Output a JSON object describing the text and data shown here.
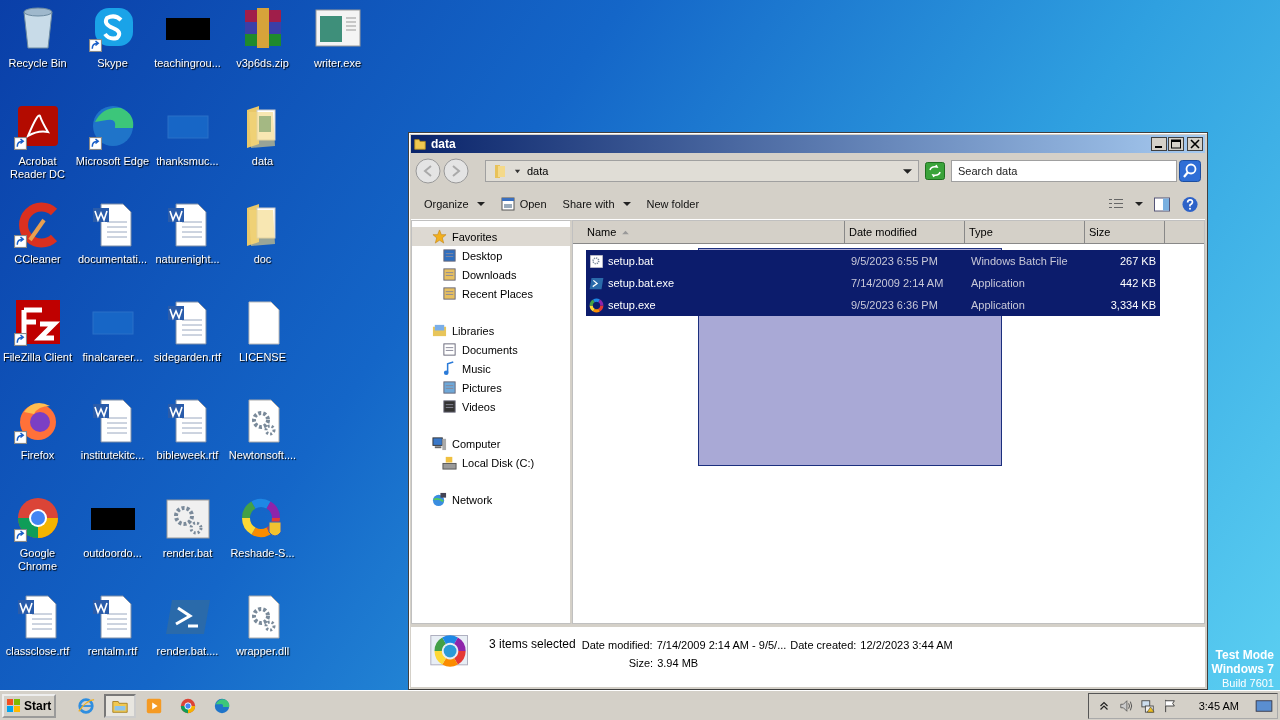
{
  "desktop": {
    "icons": [
      {
        "label": "Recycle Bin",
        "kind": "recycle",
        "shortcut": false
      },
      {
        "label": "Acrobat Reader DC",
        "kind": "acrobat",
        "shortcut": true
      },
      {
        "label": "CCleaner",
        "kind": "ccleaner",
        "shortcut": true
      },
      {
        "label": "FileZilla Client",
        "kind": "filezilla",
        "shortcut": true
      },
      {
        "label": "Firefox",
        "kind": "firefox",
        "shortcut": true
      },
      {
        "label": "Google Chrome",
        "kind": "chrome",
        "shortcut": true
      },
      {
        "label": "classclose.rtf",
        "kind": "word",
        "shortcut": false
      },
      {
        "label": "Skype",
        "kind": "skype",
        "shortcut": true
      },
      {
        "label": "Microsoft Edge",
        "kind": "edge",
        "shortcut": true
      },
      {
        "label": "documentati...",
        "kind": "word",
        "shortcut": false
      },
      {
        "label": "finalcareer...",
        "kind": "blank",
        "shortcut": false
      },
      {
        "label": "institutekitc...",
        "kind": "word",
        "shortcut": false
      },
      {
        "label": "outdoordo...",
        "kind": "black",
        "shortcut": false
      },
      {
        "label": "rentalm.rtf",
        "kind": "word",
        "shortcut": false
      },
      {
        "label": "teachingrou...",
        "kind": "black",
        "shortcut": false
      },
      {
        "label": "thanksmuc...",
        "kind": "blank",
        "shortcut": false
      },
      {
        "label": "naturenight...",
        "kind": "word",
        "shortcut": false
      },
      {
        "label": "sidegarden.rtf",
        "kind": "word",
        "shortcut": false
      },
      {
        "label": "bibleweek.rtf",
        "kind": "word",
        "shortcut": false
      },
      {
        "label": "render.bat",
        "kind": "gearwin",
        "shortcut": false
      },
      {
        "label": "render.bat....",
        "kind": "powershell",
        "shortcut": false
      },
      {
        "label": "v3p6ds.zip",
        "kind": "winrar",
        "shortcut": false
      },
      {
        "label": "data",
        "kind": "folderpic",
        "shortcut": false
      },
      {
        "label": "doc",
        "kind": "folder",
        "shortcut": false
      },
      {
        "label": "LICENSE",
        "kind": "file",
        "shortcut": false
      },
      {
        "label": "Newtonsoft....",
        "kind": "gear",
        "shortcut": false
      },
      {
        "label": "Reshade-S...",
        "kind": "ring",
        "shortcut": false
      },
      {
        "label": "wrapper.dll",
        "kind": "gear",
        "shortcut": false
      },
      {
        "label": "writer.exe",
        "kind": "window",
        "shortcut": false
      }
    ]
  },
  "window": {
    "title": "data",
    "address": "data",
    "search": {
      "placeholder": "Search data"
    },
    "toolbar": [
      {
        "label": "Organize",
        "kind": "menu"
      },
      {
        "label": "Open",
        "kind": "open"
      },
      {
        "label": "Share with",
        "kind": "menu"
      },
      {
        "label": "New folder",
        "kind": "plain"
      }
    ],
    "nav": [
      {
        "label": "Favorites",
        "kind": "star",
        "selected": true,
        "children": [
          {
            "label": "Desktop",
            "kind": "desktop",
            "selected": false
          },
          {
            "label": "Downloads",
            "kind": "downloads",
            "selected": false
          },
          {
            "label": "Recent Places",
            "kind": "recent",
            "selected": false
          }
        ]
      },
      {
        "label": "Libraries",
        "kind": "library",
        "selected": false,
        "children": [
          {
            "label": "Documents",
            "kind": "documents",
            "selected": false
          },
          {
            "label": "Music",
            "kind": "music",
            "selected": false
          },
          {
            "label": "Pictures",
            "kind": "pictures",
            "selected": false
          },
          {
            "label": "Videos",
            "kind": "videos",
            "selected": false
          }
        ]
      },
      {
        "label": "Computer",
        "kind": "computer",
        "selected": false,
        "children": [
          {
            "label": "Local Disk (C:)",
            "kind": "disk",
            "selected": false
          }
        ]
      },
      {
        "label": "Network",
        "kind": "network",
        "selected": false
      }
    ],
    "columns": [
      {
        "label": "Name",
        "sorted": true
      },
      {
        "label": "Date modified",
        "sorted": false
      },
      {
        "label": "Type",
        "sorted": false
      },
      {
        "label": "Size",
        "sorted": false
      }
    ],
    "files": [
      {
        "name": "setup.bat",
        "kind": "gear",
        "date": "9/5/2023 6:55 PM",
        "type": "Windows Batch File",
        "size": "267 KB",
        "selected": true
      },
      {
        "name": "setup.bat.exe",
        "kind": "powershell",
        "date": "7/14/2009 2:14 AM",
        "type": "Application",
        "size": "442 KB",
        "selected": true
      },
      {
        "name": "setup.exe",
        "kind": "ring",
        "date": "9/5/2023 6:36 PM",
        "type": "Application",
        "size": "3,334 KB",
        "selected": true
      }
    ],
    "details": {
      "count": "3 items selected",
      "fields": [
        {
          "label": "Date modified:",
          "value": "7/14/2009 2:14 AM - 9/5/..."
        },
        {
          "label": "Date created:",
          "value": "12/2/2023 3:44 AM"
        },
        {
          "label": "Size:",
          "value": "3.94 MB"
        }
      ]
    }
  },
  "taskbar": {
    "start": "Start",
    "apps": [
      {
        "kind": "ie",
        "active": false
      },
      {
        "kind": "explorer",
        "active": true
      },
      {
        "kind": "media",
        "active": false
      },
      {
        "kind": "chrome",
        "active": false
      },
      {
        "kind": "edge",
        "active": false
      }
    ],
    "time": "3:45 AM"
  },
  "test_mode": [
    "Test Mode",
    "Windows 7",
    "Build 7601"
  ]
}
